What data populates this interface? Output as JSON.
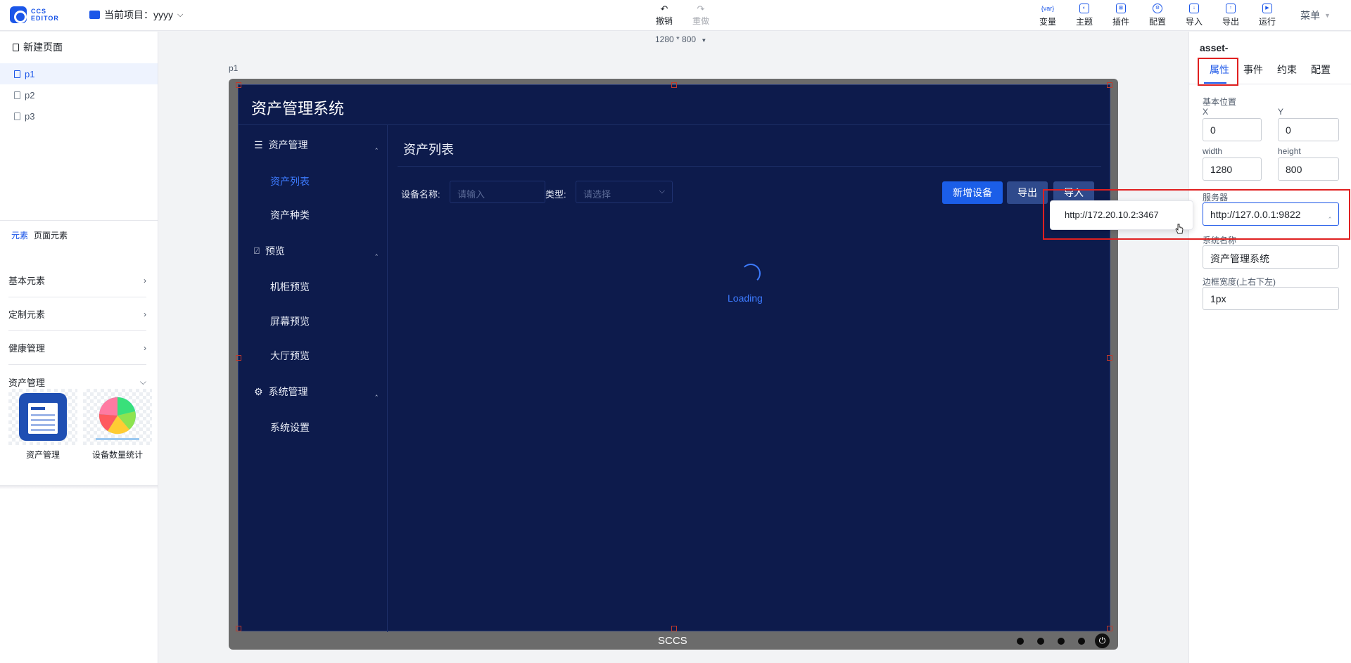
{
  "topbar": {
    "logo_text": "CCS EDITOR",
    "project_label": "当前项目：",
    "project_name": "yyyy",
    "undo": "撤销",
    "redo": "重做",
    "tools": [
      {
        "label": "变量",
        "icon": "variable-icon",
        "glyph": "{var}"
      },
      {
        "label": "主题",
        "icon": "palette-icon",
        "glyph": "◐"
      },
      {
        "label": "插件",
        "icon": "plugin-icon",
        "glyph": "⊞"
      },
      {
        "label": "配置",
        "icon": "gear-icon",
        "glyph": "⚙"
      },
      {
        "label": "导入",
        "icon": "import-icon",
        "glyph": "↓"
      },
      {
        "label": "导出",
        "icon": "export-icon",
        "glyph": "↑"
      },
      {
        "label": "运行",
        "icon": "run-icon",
        "glyph": "▶"
      }
    ],
    "menu": "菜单"
  },
  "left": {
    "new_page": "新建页面",
    "pages": [
      "p1",
      "p2",
      "p3"
    ],
    "element_tabs": [
      "元素",
      "页面元素"
    ],
    "categories": [
      "基本元素",
      "定制元素",
      "健康管理",
      "资产管理"
    ],
    "thumbs": [
      "资产管理",
      "设备数量统计"
    ]
  },
  "canvas": {
    "size": "1280 * 800",
    "page_label": "p1",
    "app_title": "资产管理系统",
    "nav": {
      "group1": "资产管理",
      "item_list": "资产列表",
      "item_type": "资产种类",
      "group2": "预览",
      "item_cabinet": "机柜预览",
      "item_screen": "屏幕预览",
      "item_hall": "大厅预览",
      "group3": "系统管理",
      "item_settings": "系统设置"
    },
    "content_title": "资产列表",
    "device_label": "设备名称:",
    "device_placeholder": "请输入",
    "type_label": "类型:",
    "type_placeholder": "请选择",
    "btn_add": "新增设备",
    "btn_export": "导出",
    "btn_import": "导入",
    "loading": "Loading",
    "footer": "SCCS",
    "colors": {
      "screen_bg": "#0d1b4c",
      "primary": "#1b5ee8",
      "frame": "#6b6b6b"
    }
  },
  "right": {
    "asset_name": "asset-",
    "tabs": [
      "属性",
      "事件",
      "约束",
      "配置"
    ],
    "basic_position": "基本位置",
    "x_label": "X",
    "x_value": "0",
    "y_label": "Y",
    "y_value": "0",
    "width_label": "width",
    "width_value": "1280",
    "height_label": "height",
    "height_value": "800",
    "server_label": "服务器",
    "server_value": "http://127.0.0.1:9822",
    "server_option": "http://172.20.10.2:3467",
    "sysname_label": "系统名称",
    "sysname_value": "资产管理系统",
    "border_label": "边框宽度(上右下左)",
    "border_value": "1px"
  }
}
